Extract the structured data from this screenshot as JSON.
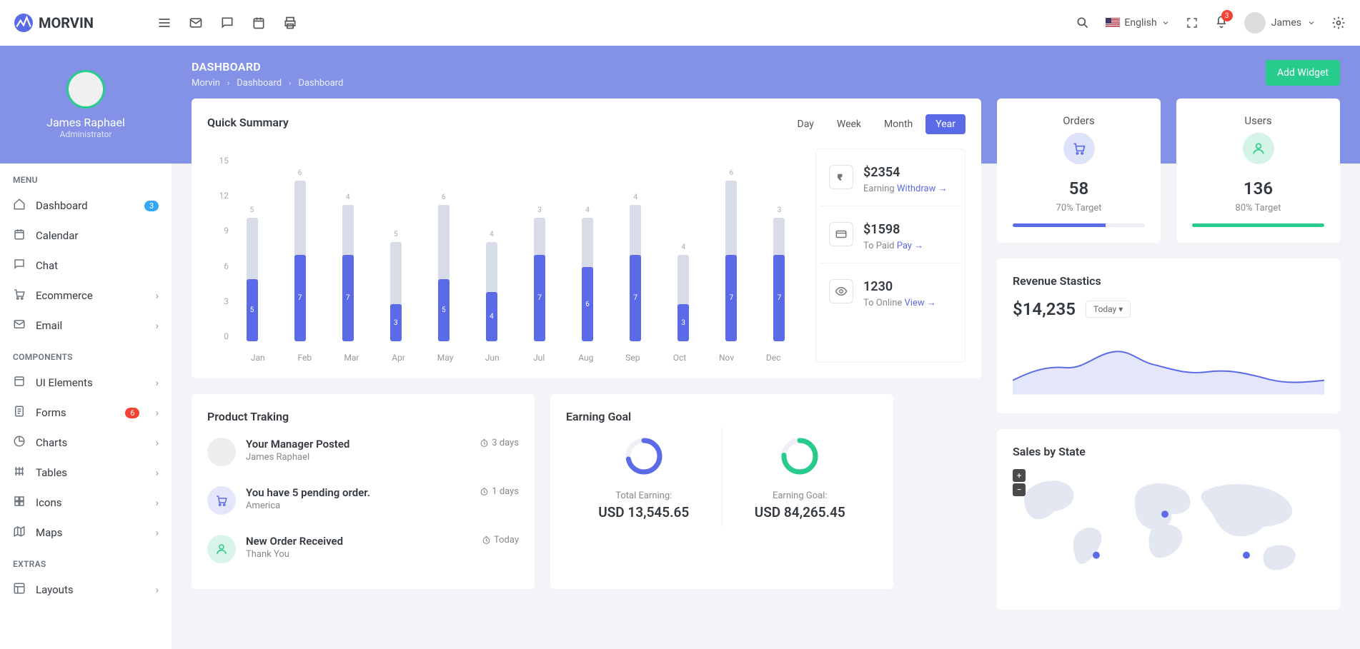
{
  "brand": "MORVIN",
  "top": {
    "lang": "English",
    "notif_count": "3",
    "user": "James"
  },
  "profile": {
    "name": "James Raphael",
    "role": "Administrator"
  },
  "nav": {
    "menu_label": "MENU",
    "components_label": "COMPONENTS",
    "extras_label": "EXTRAS",
    "menu": [
      {
        "label": "Dashboard",
        "badge": "3",
        "chev": false
      },
      {
        "label": "Calendar"
      },
      {
        "label": "Chat"
      },
      {
        "label": "Ecommerce",
        "chev": true
      },
      {
        "label": "Email",
        "chev": true
      }
    ],
    "components": [
      {
        "label": "UI Elements",
        "chev": true
      },
      {
        "label": "Forms",
        "chev": true,
        "badge": "6",
        "badge_red": true
      },
      {
        "label": "Charts",
        "chev": true
      },
      {
        "label": "Tables",
        "chev": true
      },
      {
        "label": "Icons",
        "chev": true
      },
      {
        "label": "Maps",
        "chev": true
      }
    ],
    "extras": [
      {
        "label": "Layouts",
        "chev": true
      }
    ]
  },
  "page": {
    "title": "DASHBOARD",
    "crumb1": "Morvin",
    "crumb2": "Dashboard",
    "crumb3": "Dashboard",
    "add": "Add Widget"
  },
  "summary": {
    "title": "Quick Summary",
    "seg": [
      "Day",
      "Week",
      "Month",
      "Year"
    ],
    "active": 3,
    "stats": [
      {
        "val": "$2354",
        "sub": "Earning",
        "link": "Withdraw"
      },
      {
        "val": "$1598",
        "sub": "To Paid",
        "link": "Pay"
      },
      {
        "val": "1230",
        "sub": "To Online",
        "link": "View"
      }
    ]
  },
  "chart_data": {
    "type": "bar",
    "categories": [
      "Jan",
      "Feb",
      "Mar",
      "Apr",
      "May",
      "Jun",
      "Jul",
      "Aug",
      "Sep",
      "Oct",
      "Nov",
      "Dec"
    ],
    "series": [
      {
        "name": "gray",
        "values": [
          5,
          6,
          4,
          5,
          6,
          4,
          3,
          4,
          4,
          4,
          6,
          3
        ]
      },
      {
        "name": "blue",
        "values": [
          5,
          7,
          7,
          3,
          5,
          4,
          7,
          6,
          7,
          3,
          7,
          7
        ]
      }
    ],
    "ylim": [
      0,
      15
    ],
    "yticks": [
      0,
      3,
      6,
      9,
      12,
      15
    ]
  },
  "mini": [
    {
      "title": "Orders",
      "num": "58",
      "sub": "70% Target",
      "pct": 70,
      "color": "#5b6be8"
    },
    {
      "title": "Users",
      "num": "136",
      "sub": "80% Target",
      "pct": 100,
      "color": "#27cc8d"
    }
  ],
  "revenue": {
    "title": "Revenue Stastics",
    "amount": "$14,235",
    "range": "Today"
  },
  "tracking": {
    "title": "Product Traking",
    "items": [
      {
        "t": "Your Manager Posted",
        "s": "James Raphael",
        "time": "3 days",
        "avatar": true
      },
      {
        "t": "You have 5 pending order.",
        "s": "America",
        "time": "1 days",
        "ic": "cart",
        "color": "#5b6be8",
        "bg": "#e4e7fb"
      },
      {
        "t": "New Order Received",
        "s": "Thank You",
        "time": "Today",
        "ic": "user",
        "color": "#27cc8d",
        "bg": "#d9f4e8"
      }
    ]
  },
  "goal": {
    "title": "Earning Goal",
    "cols": [
      {
        "lbl": "Total Earning:",
        "val": "USD 13,545.65",
        "pct": 72,
        "color": "#5b6be8"
      },
      {
        "lbl": "Earning Goal:",
        "val": "USD 84,265.45",
        "pct": 76,
        "color": "#27cc8d"
      }
    ]
  },
  "sales": {
    "title": "Sales by State"
  }
}
